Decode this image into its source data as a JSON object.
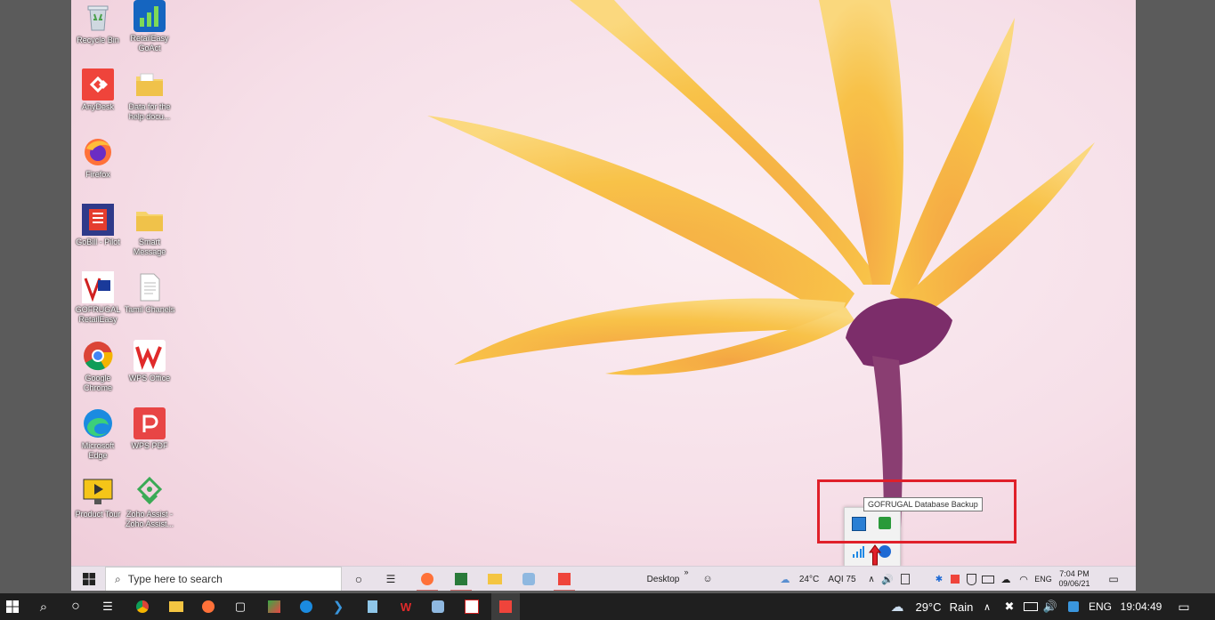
{
  "desktop_icons": [
    {
      "label": "Recycle Bin",
      "icon": "recycle-bin-icon"
    },
    {
      "label": "RetailEasy\nGoAct",
      "icon": "retaileasy-goact-icon"
    },
    {
      "label": "AnyDesk",
      "icon": "anydesk-icon"
    },
    {
      "label": "Data for the\nhelp docu...",
      "icon": "folder-icon"
    },
    {
      "label": "Firefox",
      "icon": "firefox-icon"
    },
    {
      "label": "GoBill - Pilot",
      "icon": "gobill-icon"
    },
    {
      "label": "Smart\nMessage",
      "icon": "folder-icon"
    },
    {
      "label": "GOFRUGAL\nRetailEasy",
      "icon": "gofrugal-retaileasy-icon"
    },
    {
      "label": "Tamil Chanels",
      "icon": "text-file-icon"
    },
    {
      "label": "Google\nChrome",
      "icon": "chrome-icon"
    },
    {
      "label": "WPS Office",
      "icon": "wps-office-icon"
    },
    {
      "label": "Microsoft\nEdge",
      "icon": "edge-icon"
    },
    {
      "label": "WPS PDF",
      "icon": "wps-pdf-icon"
    },
    {
      "label": "Product Tour",
      "icon": "product-tour-icon"
    },
    {
      "label": "Zoho Assist -\nZoho Assist...",
      "icon": "zoho-assist-icon"
    }
  ],
  "inner_taskbar": {
    "search_placeholder": "Type here to search",
    "toolbar_label": "Desktop",
    "toolbar_chevron": "»",
    "weather": "24°C",
    "aqi": "AQI 75",
    "language": "ENG",
    "time": "7:04 PM",
    "date": "09/06/21"
  },
  "tray_tooltip": "GOFRUGAL Database Backup",
  "outer_taskbar": {
    "weather": "29°C",
    "weather_desc": "Rain",
    "language": "ENG",
    "time": "19:04:49"
  },
  "colors": {
    "highlight_box": "#e0202a",
    "outer_taskbar": "#1f1f1f",
    "inner_taskbar": "#e9e2ea"
  }
}
